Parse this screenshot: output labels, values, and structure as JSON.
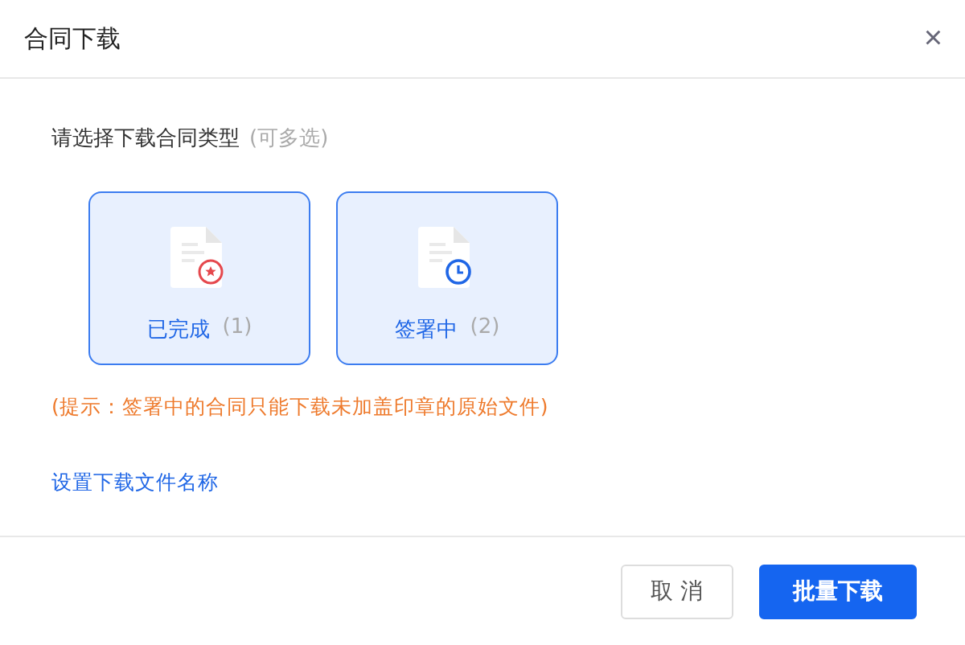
{
  "dialog": {
    "title": "合同下载",
    "close": "×"
  },
  "prompt": {
    "label": "请选择下载合同类型",
    "note": "(可多选)"
  },
  "options": [
    {
      "kind": "completed",
      "label": "已完成",
      "count": "(1)",
      "selected": true
    },
    {
      "kind": "signing",
      "label": "签署中",
      "count": "(2)",
      "selected": true
    }
  ],
  "hint": "(提示：签署中的合同只能下载未加盖印章的原始文件)",
  "link": "设置下载文件名称",
  "buttons": [
    {
      "kind": "secondary",
      "label": "取 消"
    },
    {
      "kind": "primary",
      "label": "批量下载"
    }
  ]
}
